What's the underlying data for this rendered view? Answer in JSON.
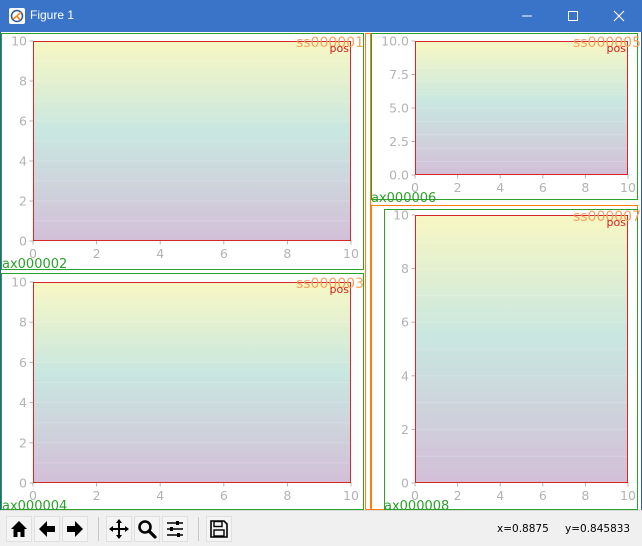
{
  "window": {
    "title": "Figure 1"
  },
  "axes": [
    {
      "id": "a1",
      "name": "ax000002",
      "title": "ss000001",
      "pos_label": "pos",
      "xticks": [
        "0",
        "2",
        "4",
        "6",
        "8",
        "10"
      ],
      "yticks": [
        "0",
        "2",
        "4",
        "6",
        "8",
        "10"
      ],
      "xlim": [
        0,
        10
      ],
      "ylim": [
        0,
        10
      ]
    },
    {
      "id": "a2",
      "name": "ax000006",
      "title": "ss000005",
      "pos_label": "pos",
      "xticks": [
        "0",
        "2",
        "4",
        "6",
        "8",
        "10"
      ],
      "yticks": [
        "0.0",
        "2.5",
        "5.0",
        "7.5",
        "10.0"
      ],
      "xlim": [
        0,
        10
      ],
      "ylim": [
        0,
        10
      ]
    },
    {
      "id": "a3",
      "name": "ax000004",
      "title": "ss000003",
      "pos_label": "pos",
      "xticks": [
        "0",
        "2",
        "4",
        "6",
        "8",
        "10"
      ],
      "yticks": [
        "0",
        "2",
        "4",
        "6",
        "8",
        "10"
      ],
      "xlim": [
        0,
        10
      ],
      "ylim": [
        0,
        10
      ]
    },
    {
      "id": "a4",
      "name": "ax000008",
      "title": "ss000007",
      "pos_label": "pos",
      "xticks": [
        "0",
        "2",
        "4",
        "6",
        "8",
        "10"
      ],
      "yticks": [
        "0",
        "2",
        "4",
        "6",
        "8",
        "10"
      ],
      "xlim": [
        0,
        10
      ],
      "ylim": [
        0,
        10
      ]
    }
  ],
  "colors": {
    "subfigure_border": "#2ca02c",
    "subfigure_border_alt": "#ff7f0e",
    "axes_border": "#d62728",
    "gradient_top": "#f7f6b8",
    "gradient_mid": "#bfe3db",
    "gradient_bottom": "#cbb4d1"
  },
  "toolbar": {
    "home": "home-icon",
    "back": "back-arrow-icon",
    "forward": "forward-arrow-icon",
    "pan": "move-icon",
    "zoom": "zoom-icon",
    "configure": "sliders-icon",
    "save": "save-icon",
    "x_readout": "x=0.8875",
    "y_readout": "y=0.845833"
  }
}
